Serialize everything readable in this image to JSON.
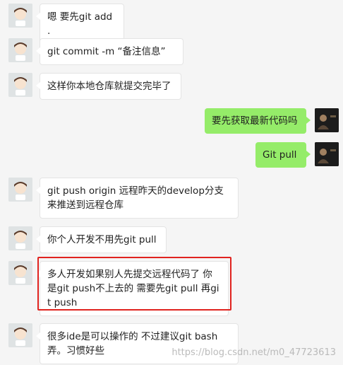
{
  "messages": [
    {
      "side": "left",
      "text": "嗯 要先git add ."
    },
    {
      "side": "left",
      "text": "git commit -m “备注信息”"
    },
    {
      "side": "left",
      "text": "这样你本地仓库就提交完毕了"
    },
    {
      "side": "right",
      "text": "要先获取最新代码吗"
    },
    {
      "side": "right",
      "text": "Git pull"
    },
    {
      "side": "left",
      "text": "git push origin 远程昨天的develop分支 来推送到远程仓库"
    },
    {
      "side": "left",
      "text": "你个人开发不用先git pull"
    },
    {
      "side": "left",
      "text": "多人开发如果别人先提交远程代码了 你是git push不上去的 需要先git pull 再git push"
    },
    {
      "side": "left",
      "text": "很多ide是可以操作的 不过建议git bash弄。习惯好些"
    }
  ],
  "watermark": "https://blog.csdn.net/m0_47723613",
  "colors": {
    "incoming": "#ffffff",
    "outgoing": "#95ec69",
    "highlight": "#e0231f"
  }
}
